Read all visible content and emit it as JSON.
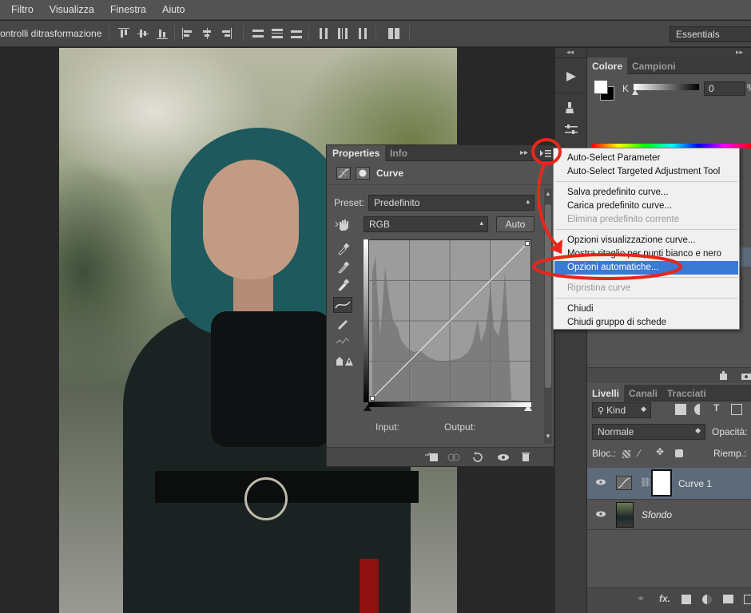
{
  "menubar": {
    "items": [
      "Filtro",
      "Visualizza",
      "Finestra",
      "Aiuto"
    ]
  },
  "optionsbar": {
    "label": "ontrolli ditrasformazione",
    "workspace": "Essentials"
  },
  "properties": {
    "tabs": [
      "Properties",
      "Info"
    ],
    "title": "Curve",
    "preset_label": "Preset:",
    "preset_value": "Predefinito",
    "channel_value": "RGB",
    "auto_label": "Auto",
    "input_label": "Input:",
    "output_label": "Output:"
  },
  "context_menu": {
    "items": [
      {
        "label": "Auto-Select Parameter",
        "state": "normal"
      },
      {
        "label": "Auto-Select Targeted Adjustment Tool",
        "state": "normal"
      },
      {
        "label": "Salva predefinito curve...",
        "state": "normal"
      },
      {
        "label": "Carica predefinito curve...",
        "state": "normal"
      },
      {
        "label": "Elimina predefinito corrente",
        "state": "disabled"
      },
      {
        "label": "Opzioni visualizzazione curve...",
        "state": "normal"
      },
      {
        "label": "Mostra ritaglio per punti bianco e nero",
        "state": "normal"
      },
      {
        "label": "Opzioni automatiche...",
        "state": "highlighted"
      },
      {
        "label": "Ripristina curve",
        "state": "disabled"
      },
      {
        "label": "Chiudi",
        "state": "normal"
      },
      {
        "label": "Chiudi gruppo di schede",
        "state": "normal"
      }
    ]
  },
  "color_panel": {
    "tabs": [
      "Colore",
      "Campioni"
    ],
    "channel_label": "K",
    "channel_value": "0",
    "unit": "%"
  },
  "layers_panel": {
    "tabs": [
      "Livelli",
      "Canali",
      "Tracciati"
    ],
    "filter_label": "Kind",
    "blend_mode": "Normale",
    "opacity_label": "Opacità:",
    "lock_label": "Bloc.:",
    "fill_label": "Riemp.:",
    "layers": [
      {
        "name": "Curve 1",
        "selected": true
      },
      {
        "name": "Sfondo",
        "selected": false
      }
    ]
  },
  "colors": {
    "highlight": "#3a79d4",
    "annotation": "#e8261b",
    "panel": "#535353"
  }
}
